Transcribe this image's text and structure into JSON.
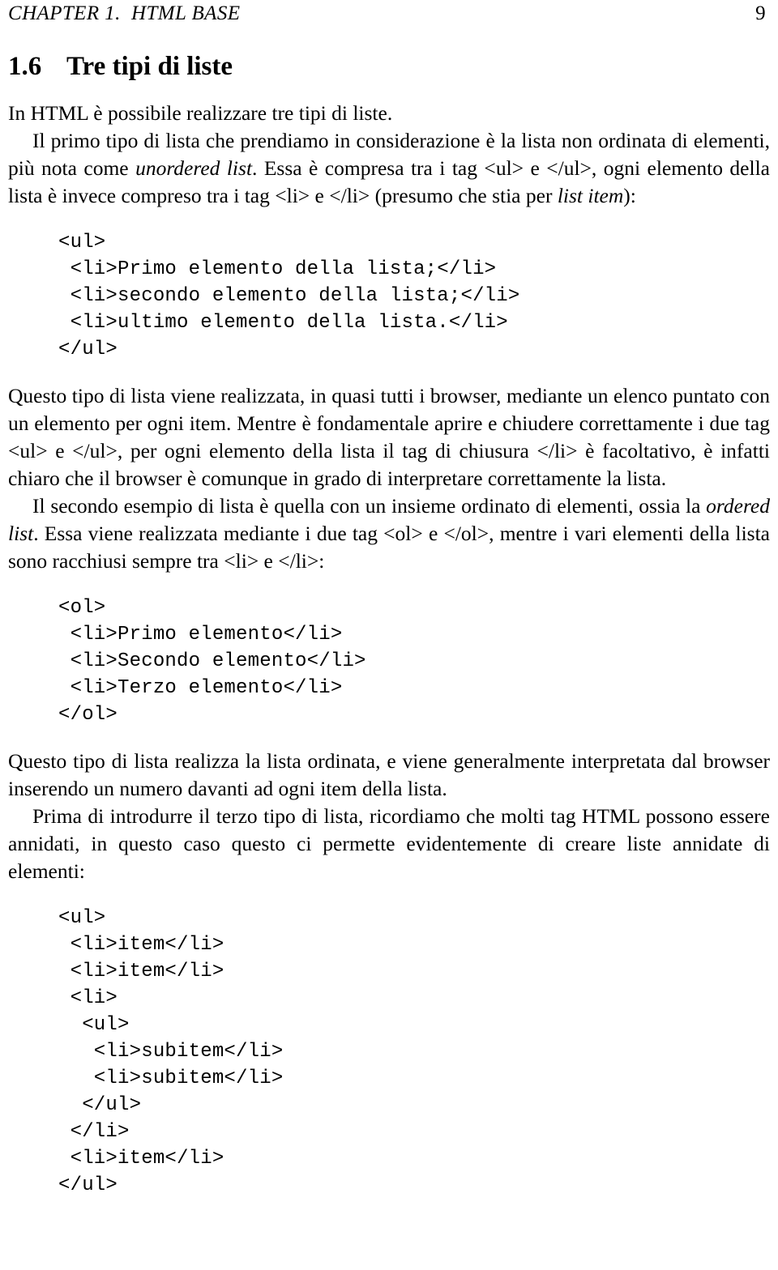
{
  "header": {
    "chapter_label": "CHAPTER 1.  HTML BASE",
    "page_number": "9"
  },
  "section": {
    "number": "1.6",
    "title": "Tre tipi di liste"
  },
  "paragraphs": {
    "p1": "In HTML è possibile realizzare tre tipi di liste.",
    "p2_part1": "Il primo tipo di lista che prendiamo in considerazione è la lista non ordinata di elementi, più nota come ",
    "p2_em1": "unordered list",
    "p2_part2": ". Essa è compresa tra i tag <ul> e </ul>, ogni elemento della lista è invece compreso tra i tag <li> e </li> (presumo che stia per ",
    "p2_em2": "list item",
    "p2_part3": "):",
    "p3": "Questo tipo di lista viene realizzata, in quasi tutti i browser, mediante un elenco puntato con un elemento per ogni item. Mentre è fondamentale aprire e chiudere correttamente i due tag <ul> e </ul>, per ogni elemento della lista il tag di chiusura </li> è facoltativo, è infatti chiaro che il browser è comunque in grado di interpretare correttamente la lista.",
    "p4_part1": "Il secondo esempio di lista è quella con un insieme ordinato di elementi, ossia la ",
    "p4_em1": "ordered list",
    "p4_part2": ". Essa viene realizzata mediante i due tag <ol> e </ol>, mentre i vari elementi della lista sono racchiusi sempre tra <li> e </li>:",
    "p5": "Questo tipo di lista realizza la lista ordinata, e viene generalmente interpretata dal browser inserendo un numero davanti ad ogni item della lista.",
    "p6": "Prima di introdurre il terzo tipo di lista, ricordiamo che molti tag HTML possono essere annidati, in questo caso questo ci permette evidentemente di creare liste annidate di elementi:"
  },
  "code_blocks": {
    "unordered_list": "<ul>\n <li>Primo elemento della lista;</li>\n <li>secondo elemento della lista;</li>\n <li>ultimo elemento della lista.</li>\n</ul>",
    "ordered_list": "<ol>\n <li>Primo elemento</li>\n <li>Secondo elemento</li>\n <li>Terzo elemento</li>\n</ol>",
    "nested_list": "<ul>\n <li>item</li>\n <li>item</li>\n <li>\n  <ul>\n   <li>subitem</li>\n   <li>subitem</li>\n  </ul>\n </li>\n <li>item</li>\n</ul>"
  },
  "colors": {
    "text": "#000000",
    "background": "#ffffff"
  }
}
